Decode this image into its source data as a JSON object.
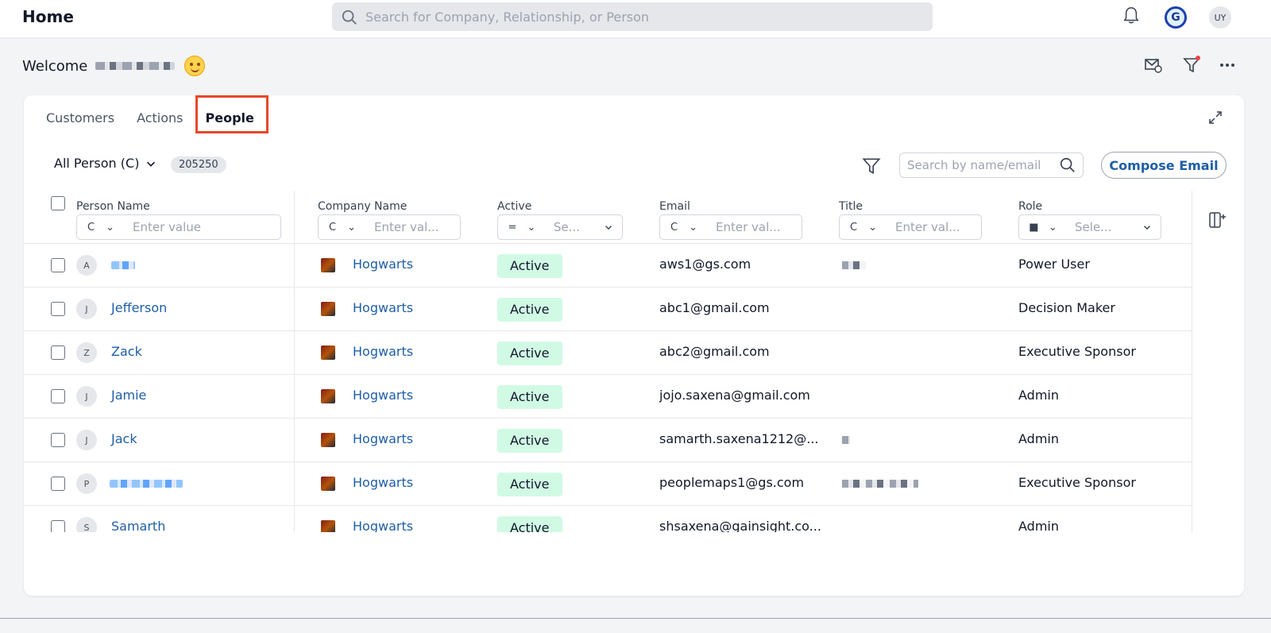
{
  "header": {
    "title": "Home",
    "search_placeholder": "Search for Company, Relationship, or Person",
    "user_initials": "UY",
    "brand_letter": "G"
  },
  "welcome": {
    "text": "Welcome"
  },
  "card": {
    "tabs": [
      {
        "label": "Customers",
        "active": false
      },
      {
        "label": "Actions",
        "active": false
      },
      {
        "label": "People",
        "active": true
      }
    ],
    "view_label": "All Person (C)",
    "count": "205250",
    "search_placeholder": "Search by name/email",
    "compose_label": "Compose Email"
  },
  "table": {
    "columns": [
      {
        "label": "Person Name",
        "operator": "C",
        "placeholder": "Enter value"
      },
      {
        "label": "Company Name",
        "operator": "C",
        "placeholder": "Enter val..."
      },
      {
        "label": "Active",
        "operator": "=",
        "placeholder": "Se..."
      },
      {
        "label": "Email",
        "operator": "C",
        "placeholder": "Enter val..."
      },
      {
        "label": "Title",
        "operator": "C",
        "placeholder": "Enter val..."
      },
      {
        "label": "Role",
        "operator": "■",
        "placeholder": "Sele..."
      }
    ],
    "rows": [
      {
        "initial": "A",
        "name": "",
        "company": "Hogwarts",
        "status": "Active",
        "email": "aws1@gs.com",
        "role": "Power User"
      },
      {
        "initial": "J",
        "name": "Jefferson",
        "company": "Hogwarts",
        "status": "Active",
        "email": "abc1@gmail.com",
        "role": "Decision Maker"
      },
      {
        "initial": "Z",
        "name": "Zack",
        "company": "Hogwarts",
        "status": "Active",
        "email": "abc2@gmail.com",
        "role": "Executive Sponsor"
      },
      {
        "initial": "J",
        "name": "Jamie",
        "company": "Hogwarts",
        "status": "Active",
        "email": "jojo.saxena@gmail.com",
        "role": "Admin"
      },
      {
        "initial": "J",
        "name": "Jack",
        "company": "Hogwarts",
        "status": "Active",
        "email": "samarth.saxena1212@...",
        "role": "Admin"
      },
      {
        "initial": "P",
        "name": "",
        "company": "Hogwarts",
        "status": "Active",
        "email": "peoplemaps1@gs.com",
        "role": "Executive Sponsor"
      },
      {
        "initial": "S",
        "name": "Samarth",
        "company": "Hogwarts",
        "status": "Active",
        "email": "shsaxena@gainsight.co...",
        "role": "Admin"
      }
    ]
  },
  "colors": {
    "link": "#1e5ea8",
    "active_badge_bg": "#d1fae5",
    "highlight_border": "#e8472a"
  }
}
